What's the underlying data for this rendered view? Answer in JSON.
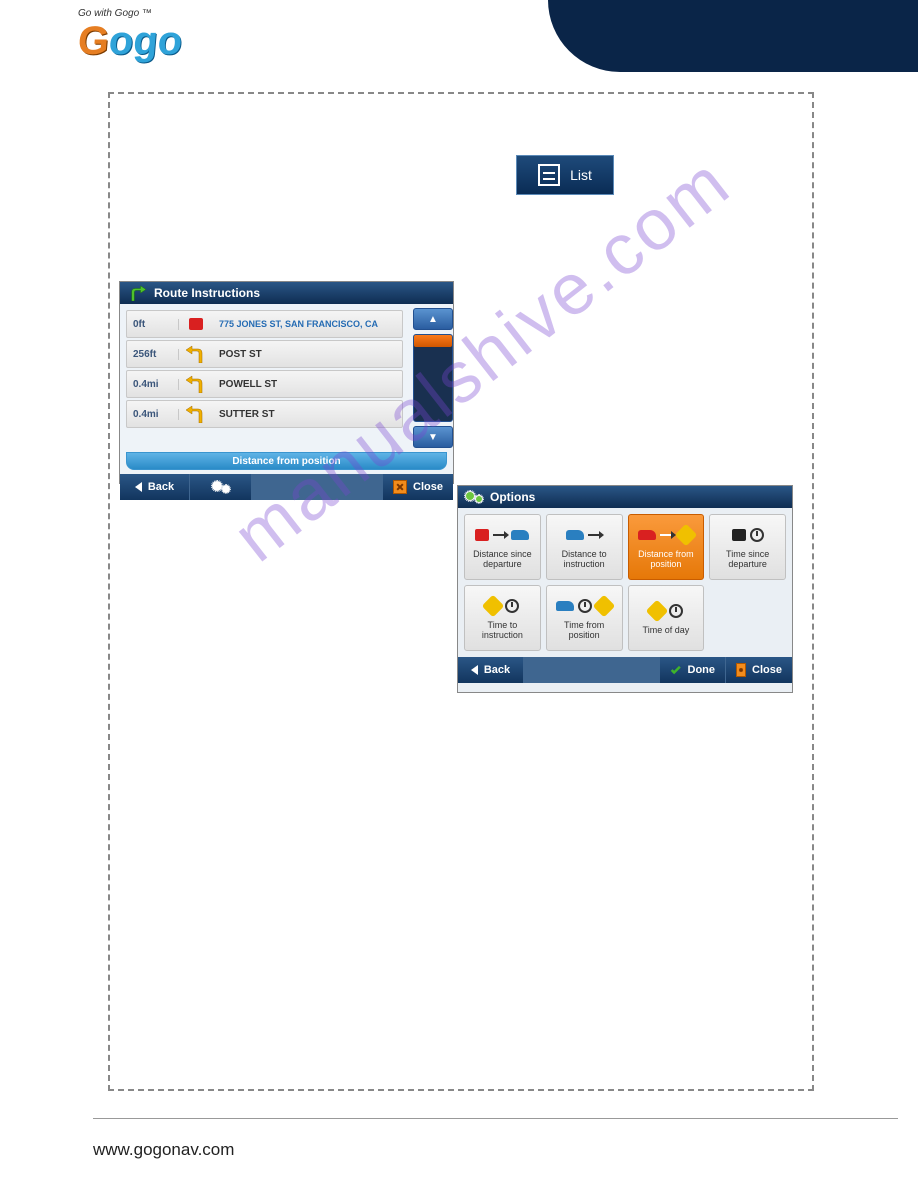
{
  "logo": {
    "tagline": "Go with Gogo ™",
    "text1": "G",
    "text2": "ogo"
  },
  "list_button": {
    "label": "List"
  },
  "route_panel": {
    "title": "Route Instructions",
    "rows": [
      {
        "dist": "0ft",
        "name": "775 JONES ST, SAN FRANCISCO, CA"
      },
      {
        "dist": "256ft",
        "name": "POST ST"
      },
      {
        "dist": "0.4mi",
        "name": "POWELL ST"
      },
      {
        "dist": "0.4mi",
        "name": "SUTTER ST"
      }
    ],
    "footer_mode": "Distance from position",
    "back": "Back",
    "close": "Close"
  },
  "options_panel": {
    "title": "Options",
    "tiles": [
      {
        "label": "Distance since departure"
      },
      {
        "label": "Distance to instruction"
      },
      {
        "label": "Distance from position",
        "selected": true
      },
      {
        "label": "Time since departure"
      },
      {
        "label": "Time to instruction"
      },
      {
        "label": "Time from position"
      },
      {
        "label": "Time of day"
      }
    ],
    "back": "Back",
    "done": "Done",
    "close": "Close"
  },
  "watermark": "manualshive.com",
  "footer_url": "www.gogonav.com"
}
